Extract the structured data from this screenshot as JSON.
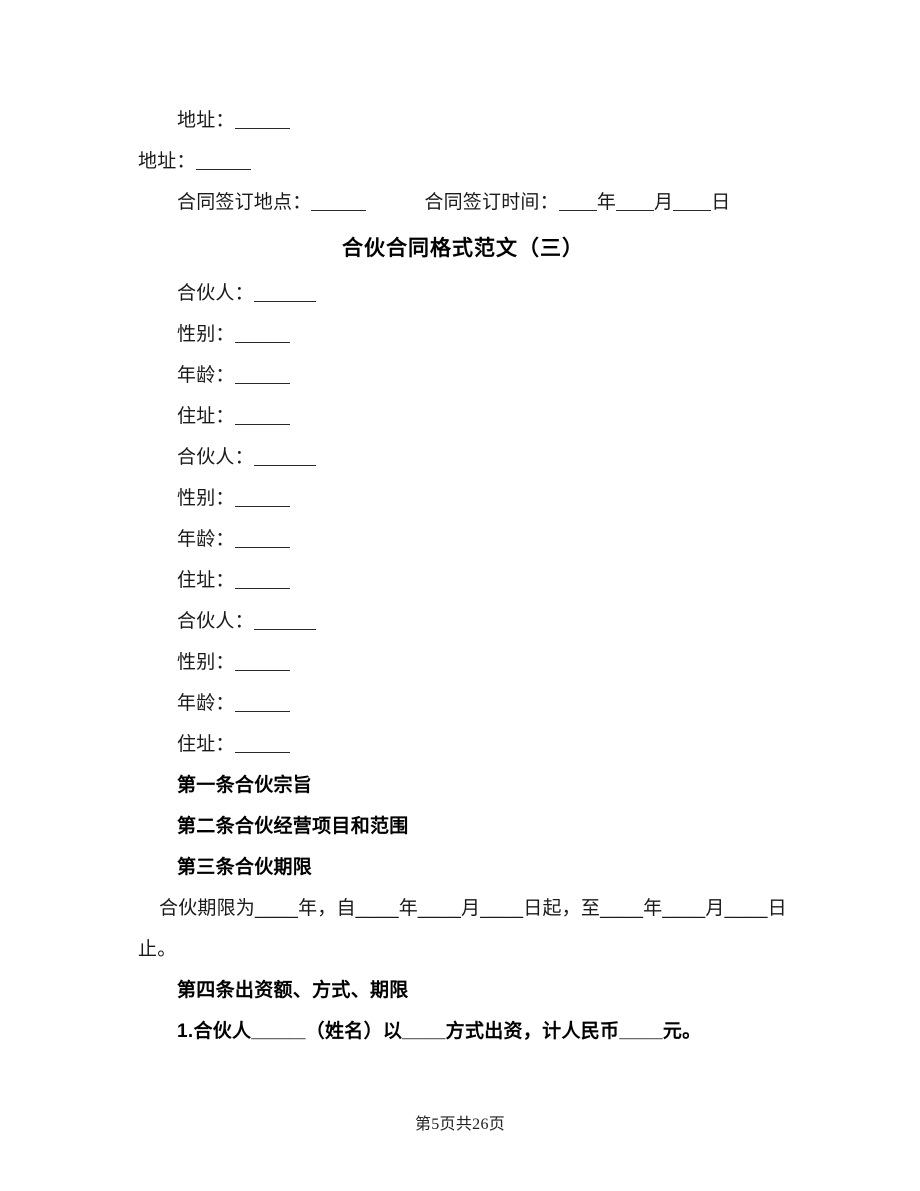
{
  "document": {
    "title": "合伙合同格式范文（三）",
    "page_footer": "第5页共26页"
  },
  "header_fields": {
    "address_label_1": "地址：",
    "address_label_2": "地址：",
    "sign_place_label": "合同签订地点：",
    "sign_time_label": "合同签订时间：",
    "year_unit": "年",
    "month_unit": "月",
    "day_unit": "日"
  },
  "partners": [
    {
      "name_label": "合伙人：",
      "gender_label": "性别：",
      "age_label": "年龄：",
      "residence_label": "住址："
    },
    {
      "name_label": "合伙人：",
      "gender_label": "性别：",
      "age_label": "年龄：",
      "residence_label": "住址："
    },
    {
      "name_label": "合伙人：",
      "gender_label": "性别：",
      "age_label": "年龄：",
      "residence_label": "住址："
    }
  ],
  "articles": {
    "article_1_heading": "第一条合伙宗旨",
    "article_2_heading": "第二条合伙经营项目和范围",
    "article_3_heading": "第三条合伙期限",
    "article_3_body": "合伙期限为____年，自____年____月____日起，至____年____月____日止。",
    "article_4_heading": "第四条出资额、方式、期限",
    "article_4_item_1": "1.合伙人_____（姓名）以____方式出资，计人民币____元。"
  }
}
